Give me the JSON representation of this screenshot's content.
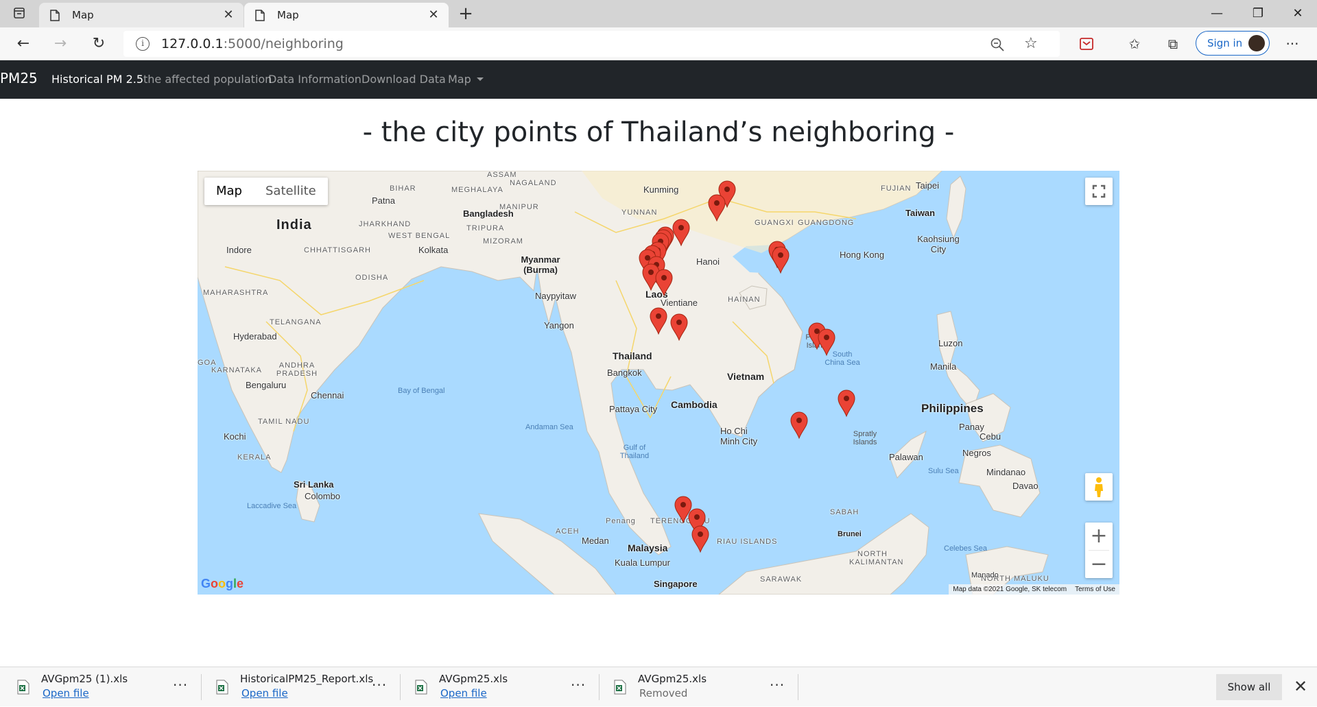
{
  "browser": {
    "tabs": [
      {
        "title": "Map",
        "active": false
      },
      {
        "title": "Map",
        "active": true
      }
    ],
    "address": {
      "host": "127.0.0.1",
      "path": ":5000/neighboring"
    },
    "signin_label": "Sign in",
    "icons": [
      "tab-actions-icon",
      "page-icon",
      "close-icon",
      "plus-icon",
      "minimize-icon",
      "restore-icon",
      "back-icon",
      "forward-icon",
      "refresh-icon",
      "info-icon",
      "zoom-out-icon",
      "add-favorite-icon",
      "extension-icon",
      "favorites-icon",
      "collections-icon",
      "more-icon"
    ],
    "glyphs": {
      "close": "✕",
      "new_tab": "+",
      "minimize": "—",
      "restore": "❐",
      "back": "←",
      "forward": "→",
      "refresh": "↻",
      "info": "i",
      "add_favorite": "☆",
      "favorites": "✩",
      "collections": "⧉",
      "more": "···"
    }
  },
  "navbar": {
    "brand": "PM25",
    "links": [
      "Historical PM 2.5",
      "the affected population",
      "Data Information",
      "Download Data",
      "Map"
    ],
    "active_link": "Historical PM 2.5"
  },
  "page": {
    "heading": "- the city points of Thailand’s neighboring -"
  },
  "map": {
    "type_buttons": [
      "Map",
      "Satellite"
    ],
    "selected_type": "Map",
    "zoom_in": "+",
    "zoom_out": "−",
    "logo_letters": [
      "G",
      "o",
      "o",
      "g",
      "l",
      "e"
    ],
    "logo_colors": [
      "#4285F4",
      "#EA4335",
      "#FBBC05",
      "#4285F4",
      "#34A853",
      "#EA4335"
    ],
    "attribution": "Map data ©2021 Google, SK telecom",
    "terms": "Terms of Use",
    "marker_color": "#ea4335",
    "labels": {
      "countries": [
        "India",
        "Bangladesh",
        "Myanmar (Burma)",
        "Laos",
        "Thailand",
        "Cambodia",
        "Vietnam",
        "Taiwan",
        "Philippines",
        "Malaysia",
        "Sri Lanka",
        "Singapore",
        "Brunei"
      ],
      "regions": [
        "BIHAR",
        "MEGHALAYA",
        "NAGALAND",
        "MANIPUR",
        "JHARKHAND",
        "WEST BENGAL",
        "TRIPURA",
        "MIZORAM",
        "CHHATTISGARH",
        "ODISHA",
        "MAHARASHTRA",
        "TELANGANA",
        "KARNATAKA",
        "ANDHRA PRADESH",
        "TAMIL NADU",
        "KERALA",
        "GOA",
        "YUNNAN",
        "GUANGXI",
        "GUANGDONG",
        "FUJIAN",
        "HAINAN",
        "ACEH",
        "TERENGGANU",
        "RIAU ISLANDS",
        "SABAH",
        "SARAWAK",
        "NORTH KALIMANTAN",
        "NORTH MALUKU",
        "ASSAM"
      ],
      "cities": [
        "Patna",
        "Kolkata",
        "Indore",
        "Hyderabad",
        "Bengaluru",
        "Chennai",
        "Kochi",
        "Colombo",
        "Kunming",
        "Hanoi",
        "Naypyitaw",
        "Yangon",
        "Vientiane",
        "Bangkok",
        "Pattaya City",
        "Ho Chi Minh City",
        "Hong Kong",
        "Taipei",
        "Kaohsiung City",
        "Luzon",
        "Manila",
        "Panay",
        "Cebu",
        "Negros",
        "Mindanao",
        "Davao",
        "Palawan",
        "Medan",
        "Kuala Lumpur",
        "Penang",
        "Manado"
      ],
      "water": [
        "Bay of Bengal",
        "Andaman Sea",
        "Gulf of Thailand",
        "South China Sea",
        "Sulu Sea",
        "Celebes Sea",
        "Laccadive Sea",
        "Paracel Islands",
        "Spratly Islands"
      ]
    },
    "city_points": [
      {
        "lon": 102.71,
        "lat": 25.04
      },
      {
        "lon": 102.18,
        "lat": 24.25
      },
      {
        "lon": 100.23,
        "lat": 22.78
      },
      {
        "lon": 99.37,
        "lat": 22.3
      },
      {
        "lon": 99.25,
        "lat": 22.15
      },
      {
        "lon": 99.1,
        "lat": 21.95
      },
      {
        "lon": 98.98,
        "lat": 21.4
      },
      {
        "lon": 98.66,
        "lat": 21.2
      },
      {
        "lon": 98.42,
        "lat": 20.96
      },
      {
        "lon": 98.9,
        "lat": 20.55
      },
      {
        "lon": 98.6,
        "lat": 20.08
      },
      {
        "lon": 99.3,
        "lat": 19.75
      },
      {
        "lon": 98.99,
        "lat": 17.4
      },
      {
        "lon": 100.1,
        "lat": 16.98
      },
      {
        "lon": 105.45,
        "lat": 21.45
      },
      {
        "lon": 105.62,
        "lat": 21.1
      },
      {
        "lon": 107.59,
        "lat": 16.46
      },
      {
        "lon": 108.1,
        "lat": 16.05
      },
      {
        "lon": 109.19,
        "lat": 12.24
      },
      {
        "lon": 106.63,
        "lat": 10.82
      },
      {
        "lon": 100.33,
        "lat": 5.41
      },
      {
        "lon": 101.08,
        "lat": 4.6
      },
      {
        "lon": 101.26,
        "lat": 3.5
      }
    ]
  },
  "downloads": {
    "items": [
      {
        "filename": "AVGpm25 (1).xls",
        "action": "Open file"
      },
      {
        "filename": "HistoricalPM25_Report.xls",
        "action": "Open file"
      },
      {
        "filename": "AVGpm25.xls",
        "action": "Open file"
      },
      {
        "filename": "AVGpm25.xls",
        "action": "Removed"
      }
    ],
    "more_label": "···",
    "show_all": "Show all",
    "close_glyph": "✕"
  }
}
